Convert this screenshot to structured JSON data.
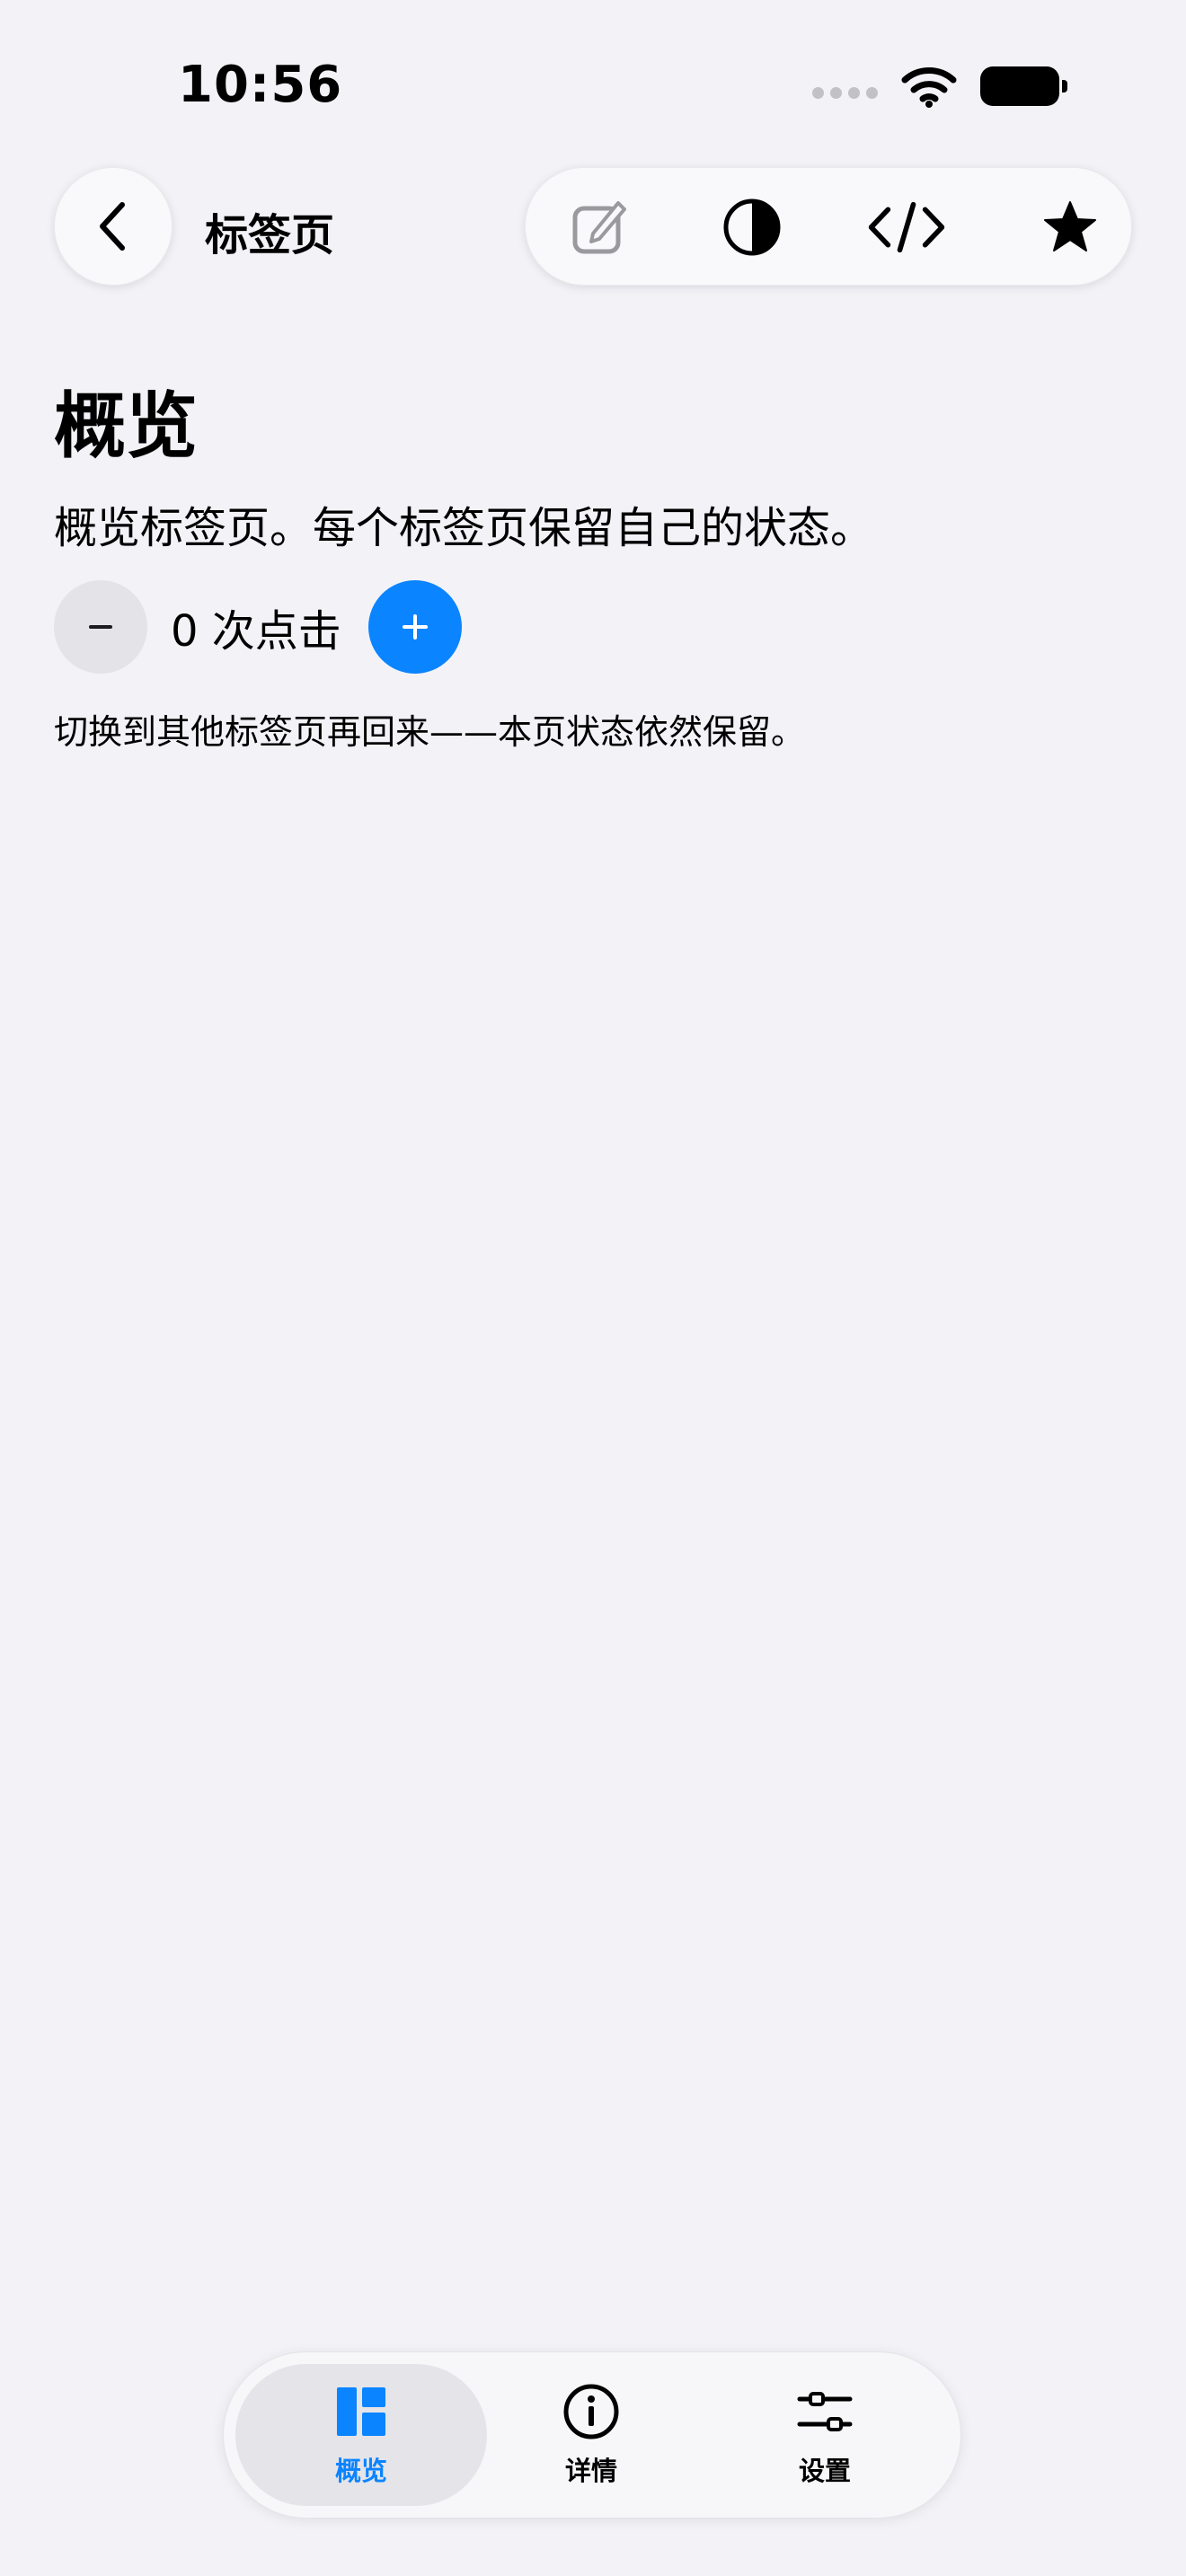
{
  "status_bar": {
    "time": "10:56"
  },
  "nav": {
    "title": "标签页",
    "toolbar_icons": [
      "compose-icon",
      "contrast-icon",
      "code-icon",
      "star-icon"
    ]
  },
  "main": {
    "title": "概览",
    "subtitle": "概览标签页。每个标签页保留自己的状态。",
    "counter_label": "0 次点击",
    "hint": "切换到其他标签页再回来——本页状态依然保留。"
  },
  "tabbar": {
    "tabs": [
      {
        "label": "概览",
        "icon": "overview-icon",
        "selected": true
      },
      {
        "label": "详情",
        "icon": "info-icon",
        "selected": false
      },
      {
        "label": "设置",
        "icon": "sliders-icon",
        "selected": false
      }
    ]
  },
  "colors": {
    "accent": "#0a84ff",
    "background": "#f2f2f7",
    "minus_button": "#e3e3e8"
  }
}
